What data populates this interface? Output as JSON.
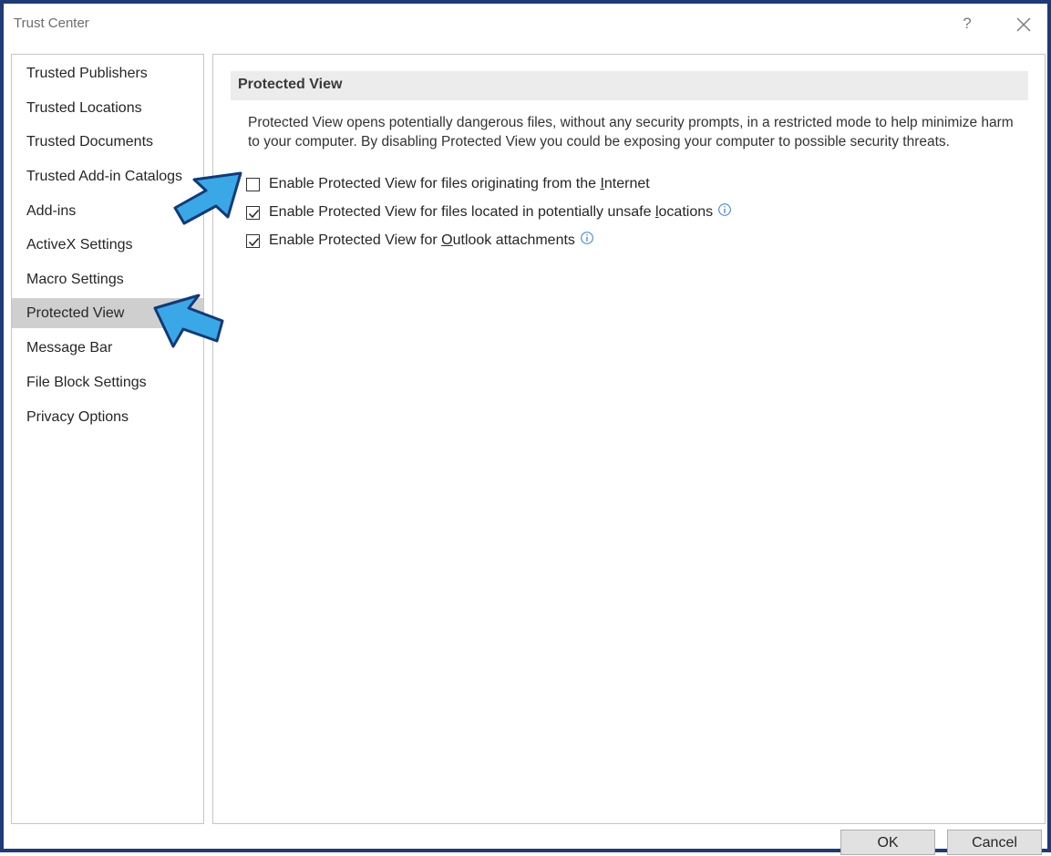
{
  "window": {
    "title": "Trust Center",
    "help_label": "?"
  },
  "sidebar": {
    "items": [
      {
        "label": "Trusted Publishers"
      },
      {
        "label": "Trusted Locations"
      },
      {
        "label": "Trusted Documents"
      },
      {
        "label": "Trusted Add-in Catalogs"
      },
      {
        "label": "Add-ins"
      },
      {
        "label": "ActiveX Settings"
      },
      {
        "label": "Macro Settings"
      },
      {
        "label": "Protected View",
        "selected": true
      },
      {
        "label": "Message Bar"
      },
      {
        "label": "File Block Settings"
      },
      {
        "label": "Privacy Options"
      }
    ]
  },
  "main": {
    "section_title": "Protected View",
    "description": "Protected View opens potentially dangerous files, without any security prompts, in a restricted mode to help minimize harm to your computer. By disabling Protected View you could be exposing your computer to possible security threats.",
    "options": [
      {
        "pre": "Enable Protected View for files originating from the ",
        "key": "I",
        "post": "nternet",
        "checked": false,
        "info": false
      },
      {
        "pre": "Enable Protected View for files located in potentially unsafe ",
        "key": "l",
        "post": "ocations",
        "checked": true,
        "info": true
      },
      {
        "pre": "Enable Protected View for ",
        "key": "O",
        "post": "utlook attachments",
        "checked": true,
        "info": true
      }
    ]
  },
  "footer": {
    "ok_label": "OK",
    "cancel_label": "Cancel"
  },
  "colors": {
    "frame_border": "#1f3a78",
    "annotation_arrow_fill": "#3aa8e6",
    "annotation_arrow_stroke": "#123a78",
    "info_icon": "#2b7cd3"
  }
}
